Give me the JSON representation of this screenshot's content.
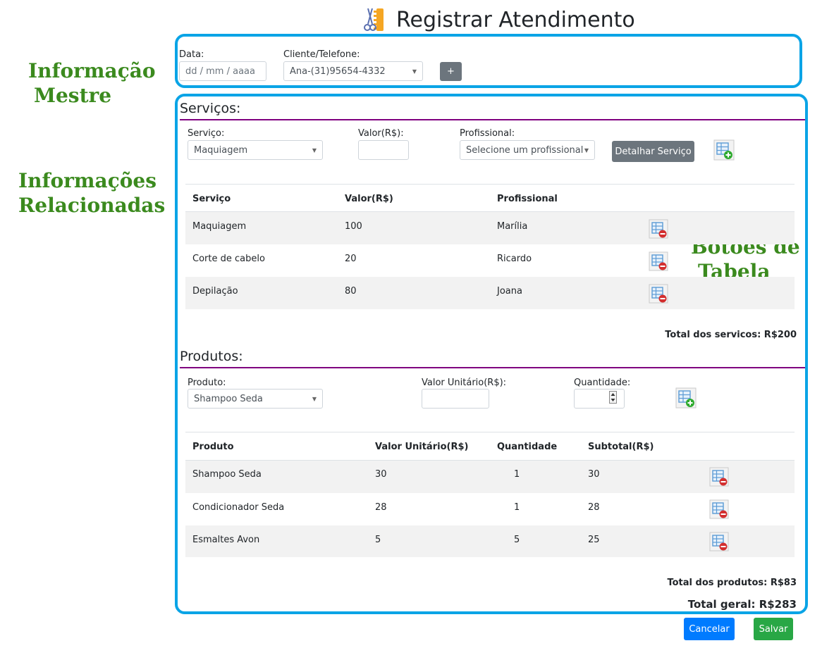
{
  "header": {
    "title": "Registrar Atendimento"
  },
  "annotations": {
    "master_line1": "Informação",
    "master_line2": "Mestre",
    "related_line1": "Informações",
    "related_line2": "Relacionadas",
    "table_buttons_line1": "Botões de",
    "table_buttons_line2": "Tabela"
  },
  "master": {
    "date_label": "Data:",
    "date_placeholder": "dd / mm / aaaa",
    "client_label": "Cliente/Telefone:",
    "client_value": "Ana-(31)95654-4332",
    "add_client_label": "+"
  },
  "services": {
    "title": "Serviços:",
    "service_label": "Serviço:",
    "service_value": "Maquiagem",
    "value_label": "Valor(R$):",
    "professional_label": "Profissional:",
    "professional_value": "Selecione um profissional",
    "detail_button": "Detalhar Serviço",
    "columns": [
      "Serviço",
      "Valor(R$)",
      "Profissional"
    ],
    "rows": [
      {
        "service": "Maquiagem",
        "value": "100",
        "professional": "Marília"
      },
      {
        "service": "Corte de cabelo",
        "value": "20",
        "professional": "Ricardo"
      },
      {
        "service": "Depilação",
        "value": "80",
        "professional": "Joana"
      }
    ],
    "total": "Total dos servicos: R$200"
  },
  "products": {
    "title": "Produtos:",
    "product_label": "Produto:",
    "product_value": "Shampoo Seda",
    "unit_value_label": "Valor Unitário(R$):",
    "quantity_label": "Quantidade:",
    "columns": [
      "Produto",
      "Valor Unitário(R$)",
      "Quantidade",
      "Subtotal(R$)"
    ],
    "rows": [
      {
        "product": "Shampoo Seda",
        "unit": "30",
        "qty": "1",
        "subtotal": "30"
      },
      {
        "product": "Condicionador Seda",
        "unit": "28",
        "qty": "1",
        "subtotal": "28"
      },
      {
        "product": "Esmaltes Avon",
        "unit": "5",
        "qty": "5",
        "subtotal": "25"
      }
    ],
    "total": "Total dos produtos: R$83"
  },
  "grand_total": "Total geral: R$283",
  "footer": {
    "cancel_label": "Cancelar",
    "save_label": "Salvar"
  },
  "colors": {
    "panel_border": "#0aa4e6",
    "annotation_green": "#3b8a1e",
    "section_rule": "#800080",
    "button_gray": "#6c757d",
    "button_blue": "#007bff",
    "button_green": "#28a745"
  }
}
